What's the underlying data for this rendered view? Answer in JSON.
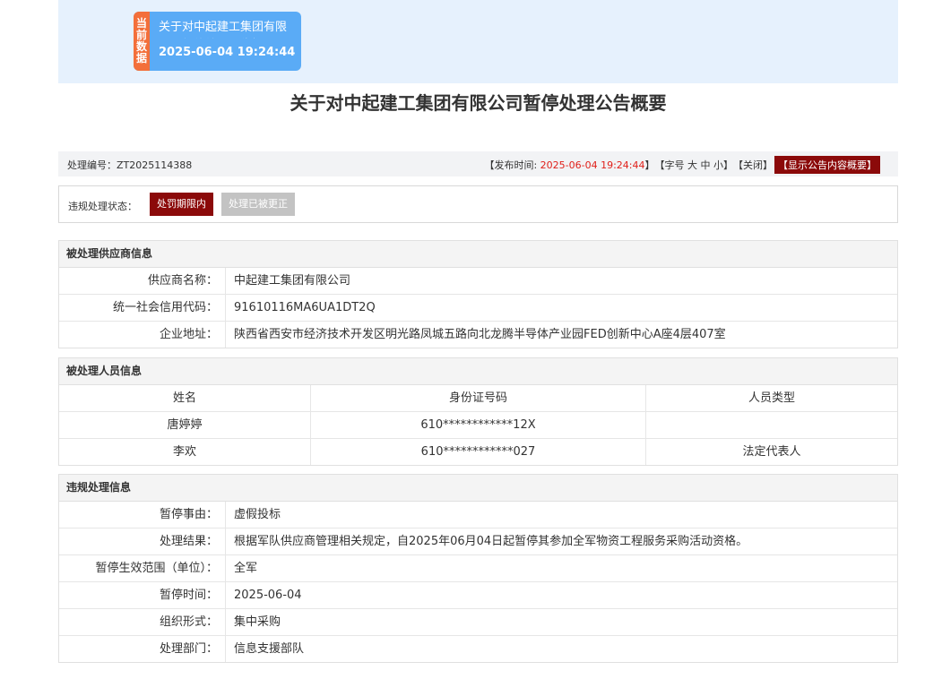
{
  "current_card": {
    "tag": [
      "当",
      "前",
      "数",
      "据"
    ],
    "title": "关于对中起建工集团有限公司暂停处理公告概要",
    "time": "2025-06-04 19:24:44"
  },
  "page_title": "关于对中起建工集团有限公司暂停处理公告概要",
  "meta": {
    "id_label": "处理编号：",
    "id_value": "ZT2025114388",
    "publish_label": "【发布时间: ",
    "publish_time": "2025-06-04 19:24:44",
    "publish_close": "】",
    "font_label": "【字号 ",
    "font_large": "大",
    "font_medium": "中",
    "font_small": "小",
    "font_close": "】",
    "close_link": "【关闭】",
    "summary_button": "【显示公告内容概要】"
  },
  "status": {
    "label": "违规处理状态：",
    "active": "处罚期限内",
    "inactive": "处理已被更正"
  },
  "supplier": {
    "heading": "被处理供应商信息",
    "rows": [
      {
        "k": "供应商名称：",
        "v": "中起建工集团有限公司"
      },
      {
        "k": "统一社会信用代码：",
        "v": "91610116MA6UA1DT2Q"
      },
      {
        "k": "企业地址：",
        "v": "陕西省西安市经济技术开发区明光路凤城五路向北龙腾半导体产业园FED创新中心A座4层407室"
      }
    ]
  },
  "persons": {
    "heading": "被处理人员信息",
    "columns": [
      "姓名",
      "身份证号码",
      "人员类型"
    ],
    "rows": [
      [
        "唐婷婷",
        "610************12X",
        ""
      ],
      [
        "李欢",
        "610************027",
        "法定代表人"
      ]
    ]
  },
  "violation": {
    "heading": "违规处理信息",
    "rows": [
      {
        "k": "暂停事由：",
        "v": "虚假投标"
      },
      {
        "k": "处理结果：",
        "v": "根据军队供应商管理相关规定，自2025年06月04日起暂停其参加全军物资工程服务采购活动资格。"
      },
      {
        "k": "暂停生效范围（单位）：",
        "v": "全军"
      },
      {
        "k": "暂停时间：",
        "v": "2025-06-04"
      },
      {
        "k": "组织形式：",
        "v": "集中采购"
      },
      {
        "k": "处理部门：",
        "v": "信息支援部队"
      }
    ]
  }
}
